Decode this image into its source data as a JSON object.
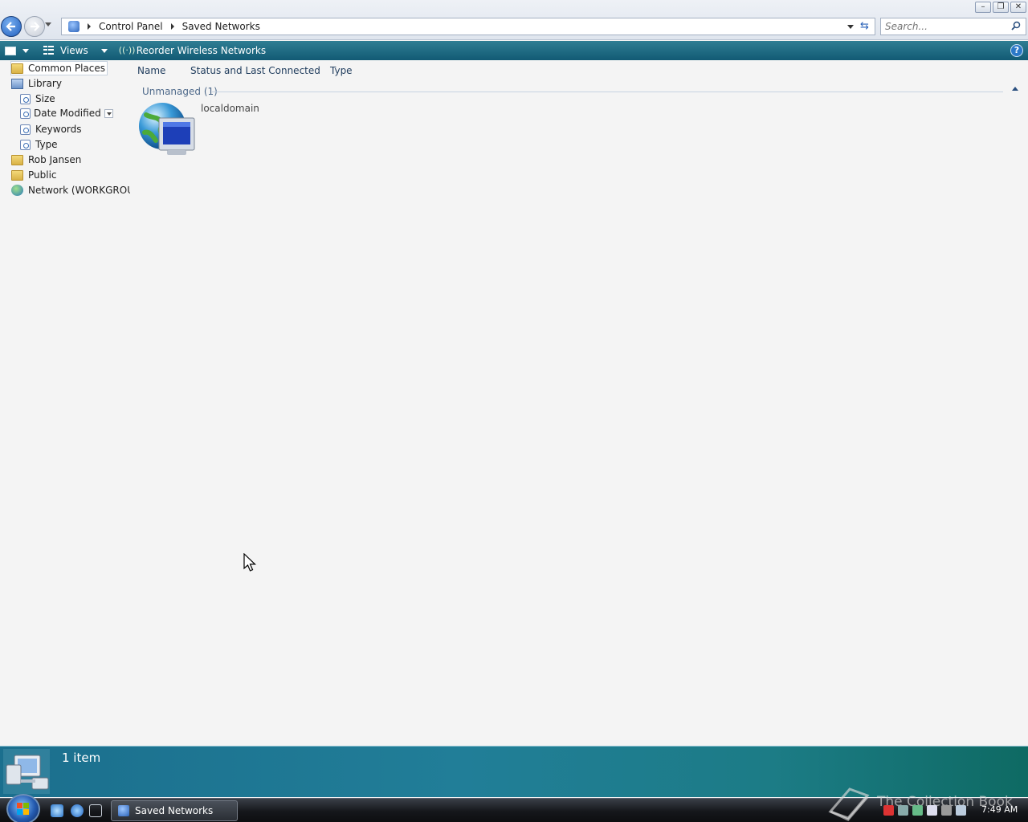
{
  "window": {
    "breadcrumbs": [
      "Control Panel",
      "Saved Networks"
    ],
    "search_placeholder": "Search..."
  },
  "commandbar": {
    "views_label": "Views",
    "reorder_label": "Reorder Wireless Networks"
  },
  "navpane": {
    "items": [
      {
        "label": "Common Places",
        "icon": "folder-icon"
      },
      {
        "label": "Library",
        "icon": "library-icon"
      },
      {
        "label": "Size",
        "icon": "search-folder-icon"
      },
      {
        "label": "Date Modified",
        "icon": "search-folder-icon"
      },
      {
        "label": "Keywords",
        "icon": "search-folder-icon"
      },
      {
        "label": "Type",
        "icon": "search-folder-icon"
      },
      {
        "label": "Rob Jansen",
        "icon": "folder-icon"
      },
      {
        "label": "Public",
        "icon": "folder-icon"
      },
      {
        "label": "Network (WORKGROUP",
        "icon": "network-icon"
      }
    ]
  },
  "content": {
    "columns": [
      "Name",
      "Status and Last Connected",
      "Type"
    ],
    "group_label": "Unmanaged (1)",
    "items": [
      {
        "name": "localdomain",
        "icon": "network-globe-icon"
      }
    ]
  },
  "details": {
    "count": "1 item"
  },
  "taskbar": {
    "task_label": "Saved Networks",
    "watermark": "The Collection Book",
    "clock": "7:49 AM"
  },
  "colors": {
    "commandbar": "#1b6f8e",
    "details": "#217e98",
    "taskbar": "#15171b"
  }
}
